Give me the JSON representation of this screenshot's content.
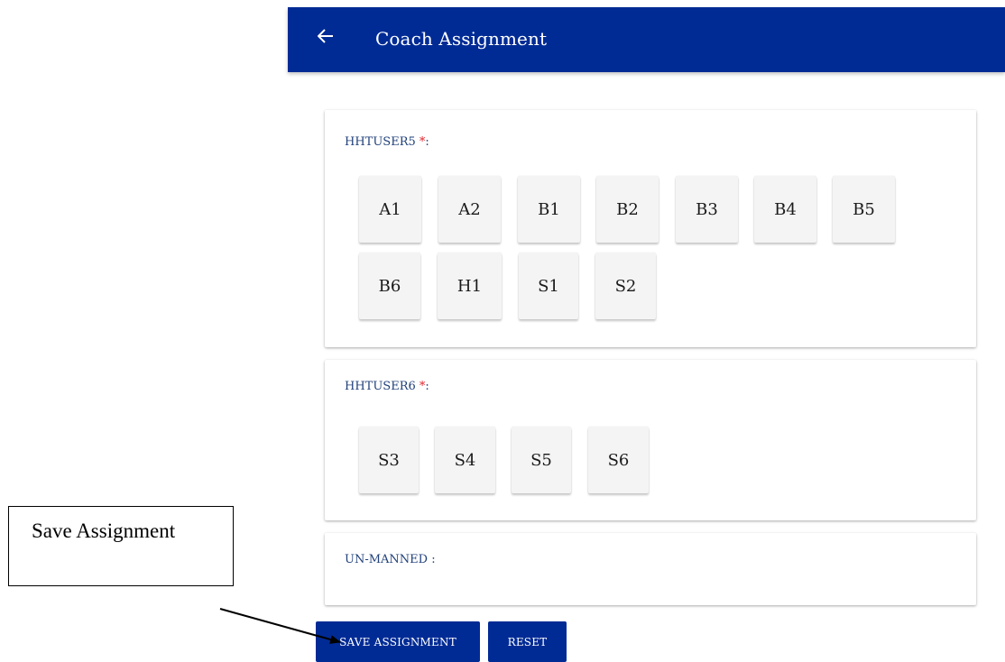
{
  "header": {
    "title": "Coach Assignment",
    "back_icon": "arrow-left-icon"
  },
  "groups": [
    {
      "label": "HHTUSER5",
      "required_mark": "*",
      "suffix": ":",
      "coaches": [
        "A1",
        "A2",
        "B1",
        "B2",
        "B3",
        "B4",
        "B5",
        "B6",
        "H1",
        "S1",
        "S2"
      ]
    },
    {
      "label": "HHTUSER6",
      "required_mark": "*",
      "suffix": ":",
      "coaches": [
        "S3",
        "S4",
        "S5",
        "S6"
      ]
    },
    {
      "label": "UN-MANNED :",
      "coaches": []
    }
  ],
  "actions": {
    "save": "SAVE ASSIGNMENT",
    "reset": "RESET"
  },
  "annotation": {
    "text": "Save Assignment"
  },
  "colors": {
    "primary": "#002b95",
    "required": "#e0262c",
    "label": "#1f3f7a",
    "coach_bg": "#f4f4f4"
  }
}
